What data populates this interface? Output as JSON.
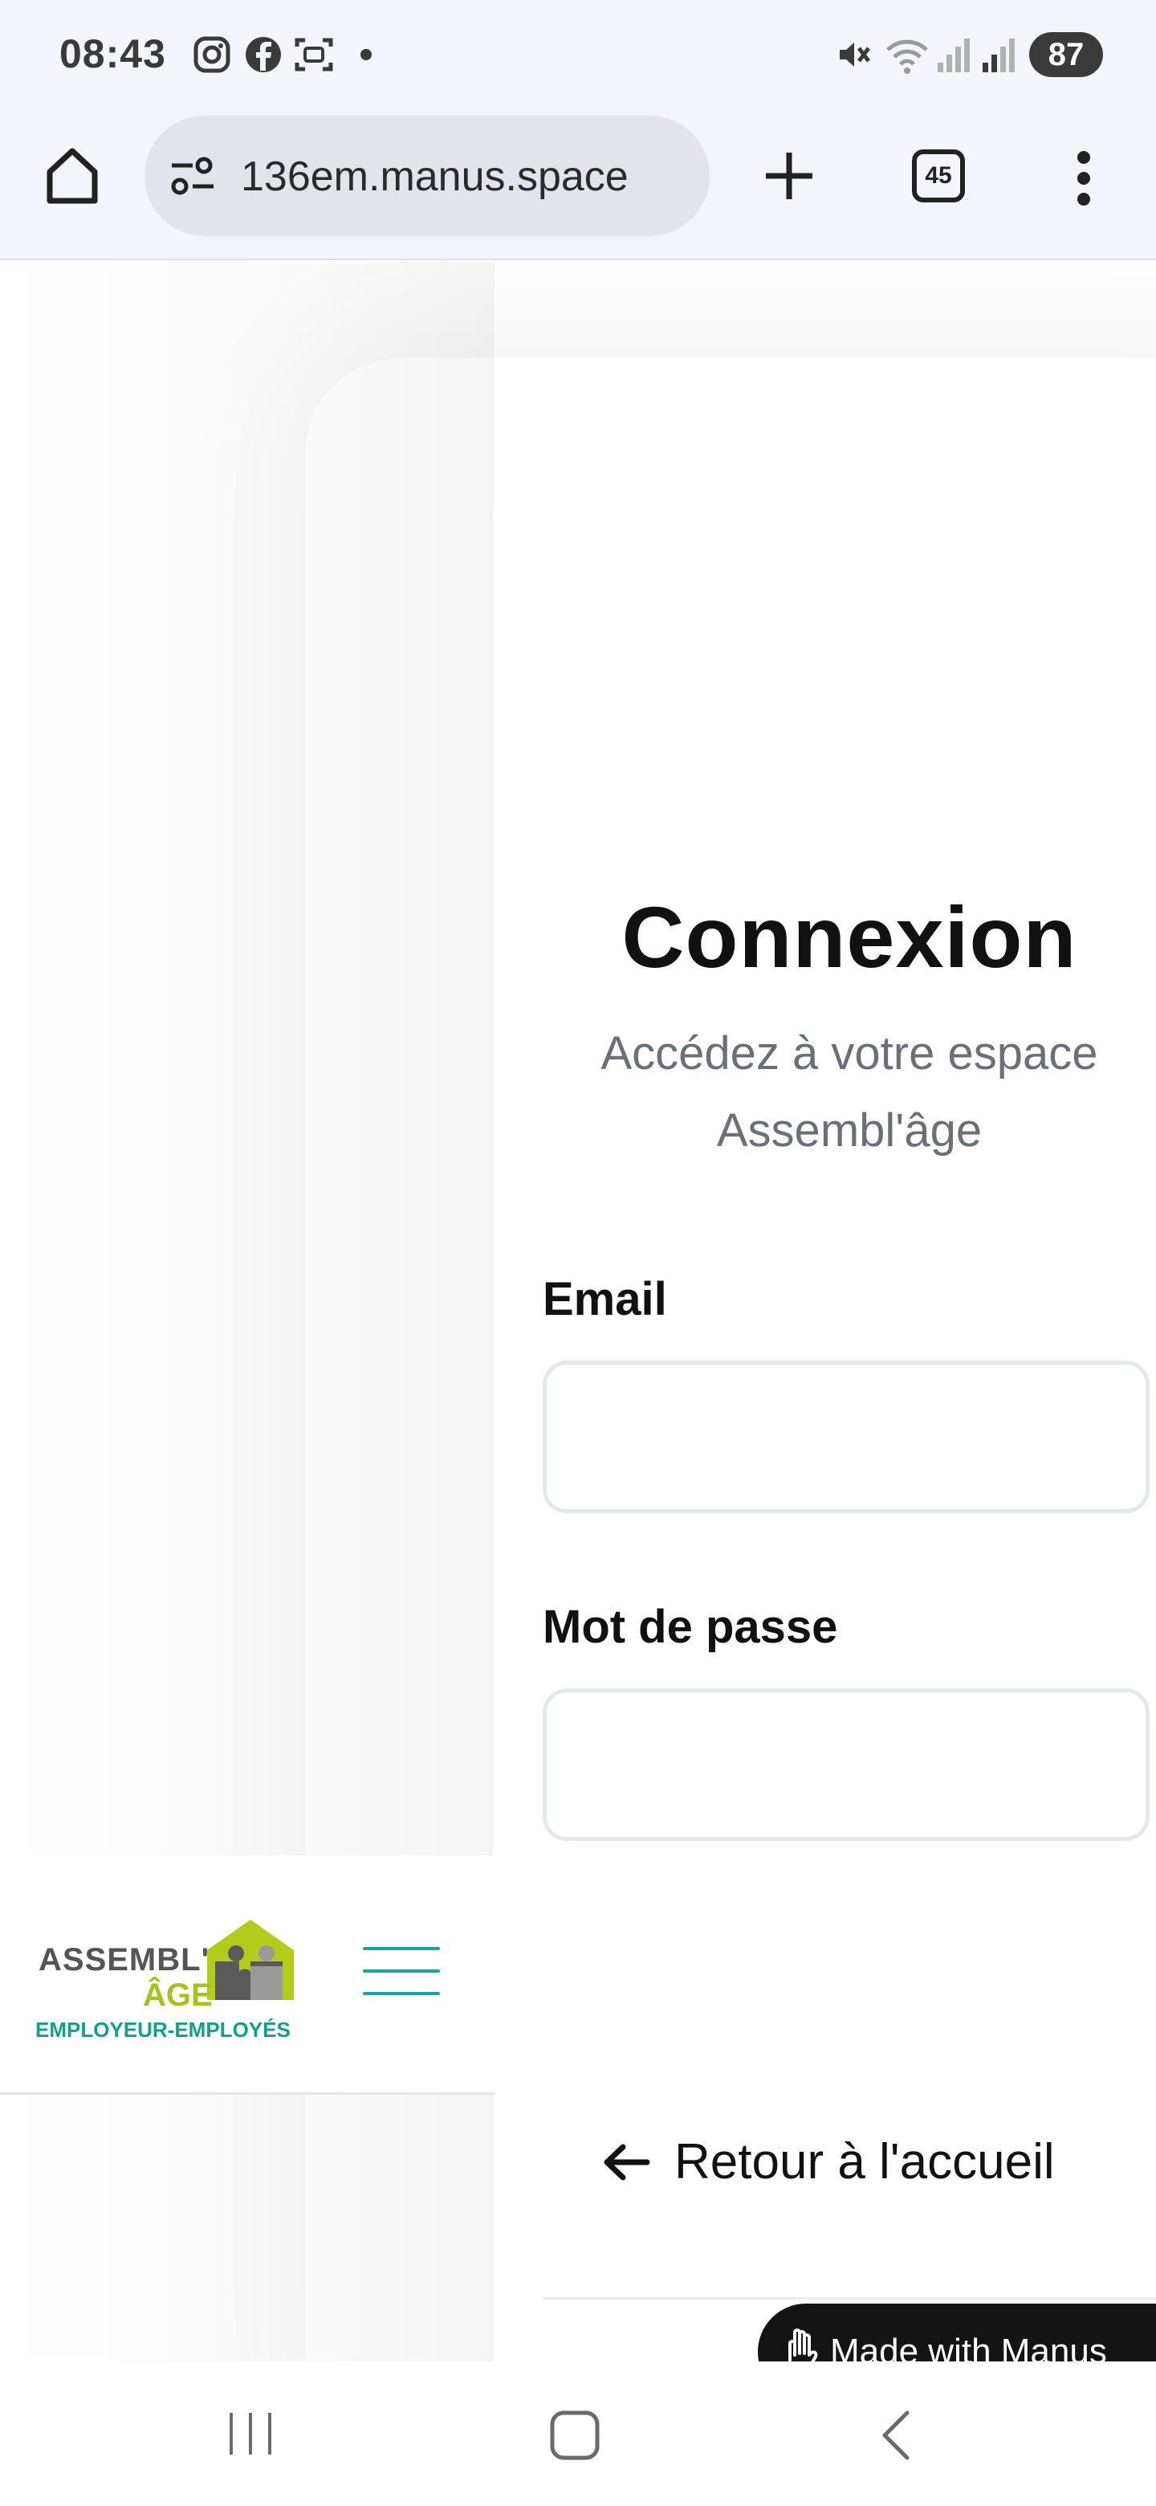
{
  "status_bar": {
    "time": "08:43",
    "battery": "87",
    "icons": [
      "instagram-icon",
      "facebook-icon",
      "screenshot-icon",
      "dot-icon",
      "mute-icon",
      "wifi-icon",
      "signal-icon",
      "signal-icon"
    ]
  },
  "browser": {
    "url": "136em.manus.space",
    "tab_count": "45",
    "icons": [
      "home-icon",
      "site-settings-icon",
      "new-tab-icon",
      "tabs-icon",
      "menu-icon"
    ]
  },
  "login": {
    "title": "Connexion",
    "subtitle": "Accédez à votre espace Assembl'âge",
    "email_label": "Email",
    "email_value": "",
    "password_label": "Mot de passe",
    "password_value": "",
    "back_link": "Retour à l'accueil"
  },
  "site_header": {
    "logo_line1": "ASSEMBL'",
    "logo_line2": "ÂGE",
    "logo_line3": "EMPLOYEUR-EMPLOYÉS"
  },
  "badge": {
    "label": "Made with Manus"
  },
  "colors": {
    "brand_green": "#a6c21c",
    "brand_teal": "#12a08a",
    "hamburger": "#1aa3a3"
  }
}
